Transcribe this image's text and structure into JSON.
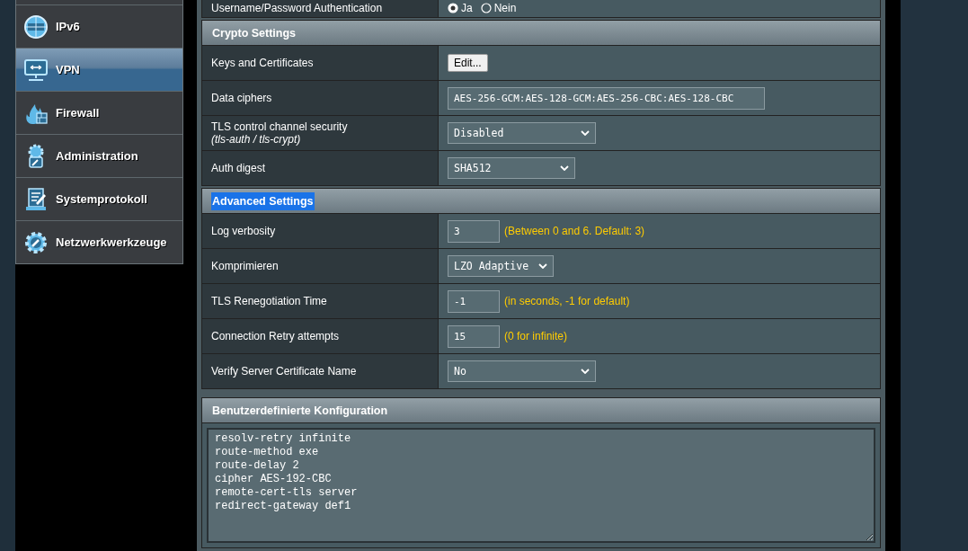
{
  "sidebar": {
    "items": [
      {
        "label": "IPv6",
        "selected": false
      },
      {
        "label": "VPN",
        "selected": true
      },
      {
        "label": "Firewall",
        "selected": false
      },
      {
        "label": "Administration",
        "selected": false
      },
      {
        "label": "Systemprotokoll",
        "selected": false
      },
      {
        "label": "Netzwerkwerkzeuge",
        "selected": false
      }
    ]
  },
  "top_row": {
    "label": "Username/Password Authentication",
    "options": [
      {
        "label": "Ja",
        "selected": true
      },
      {
        "label": "Nein",
        "selected": false
      }
    ]
  },
  "sections": [
    {
      "title": "Crypto Settings",
      "highlighted": false,
      "rows": [
        {
          "kind": "button",
          "label": "Keys and Certificates",
          "value": "Edit..."
        },
        {
          "kind": "text",
          "label": "Data ciphers",
          "value": "AES-256-GCM:AES-128-GCM:AES-256-CBC:AES-128-CBC"
        },
        {
          "kind": "select",
          "label": "TLS control channel security",
          "sublabel": "(tls-auth / tls-crypt)",
          "value": "Disabled"
        },
        {
          "kind": "select",
          "label": "Auth digest",
          "value": "SHA512"
        }
      ]
    },
    {
      "title": "Advanced Settings",
      "highlighted": true,
      "rows": [
        {
          "kind": "text",
          "label": "Log verbosity",
          "value": "3",
          "hint": "(Between 0 and 6. Default: 3)"
        },
        {
          "kind": "select",
          "label": "Komprimieren",
          "value": "LZO Adaptive"
        },
        {
          "kind": "text",
          "label": "TLS Renegotiation Time",
          "value": "-1",
          "hint": "(in seconds, -1 for default)"
        },
        {
          "kind": "text",
          "label": "Connection Retry attempts",
          "value": "15",
          "hint": "(0 for infinite)"
        },
        {
          "kind": "select",
          "label": "Verify Server Certificate Name",
          "value": "No"
        }
      ]
    }
  ],
  "custom_config": {
    "title": "Benutzerdefinierte Konfiguration",
    "value": "resolv-retry infinite\nroute-method exe\nroute-delay 2\ncipher AES-192-CBC\nremote-cert-tls server\nredirect-gateway def1"
  }
}
